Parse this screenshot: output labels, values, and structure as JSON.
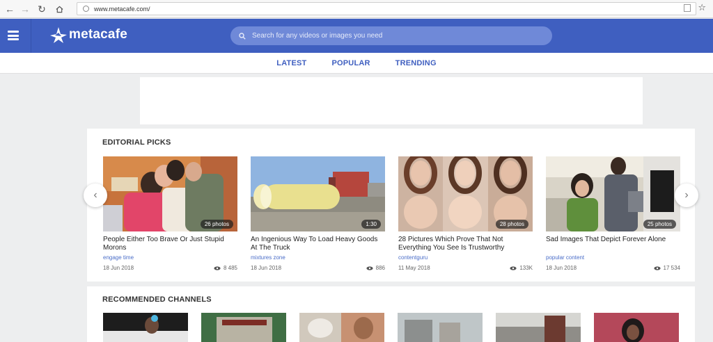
{
  "browser": {
    "url": "www.metacafe.com/",
    "back_icon": "arrow-left",
    "forward_icon": "arrow-right",
    "reload_icon": "reload",
    "home_icon": "home",
    "bookmark_icon": "star"
  },
  "header": {
    "logo_text": "metacafe",
    "search_placeholder": "Search for any videos or images you need",
    "brand_color": "#3f5fc0"
  },
  "subnav": {
    "items": [
      "LATEST",
      "POPULAR",
      "TRENDING"
    ]
  },
  "editorial": {
    "title": "EDITORIAL PICKS",
    "items": [
      {
        "title": "People Either Too Brave Or Just Stupid Morons",
        "source": "engage time",
        "date": "18 Jun 2018",
        "views": "8 485",
        "badge": "26 photos"
      },
      {
        "title": "An Ingenious Way To Load Heavy Goods At The Truck",
        "source": "mixtures zone",
        "date": "18 Jun 2018",
        "views": "886",
        "badge": "1:30"
      },
      {
        "title": "28 Pictures Which Prove That Not Everything You See Is Trustworthy",
        "source": "contentguru",
        "date": "11 May 2018",
        "views": "133K",
        "badge": "28 photos"
      },
      {
        "title": "Sad Images That Depict Forever Alone",
        "source": "popular content",
        "date": "18 Jun 2018",
        "views": "17 534",
        "badge": "25 photos"
      }
    ],
    "prev_icon": "chevron-left",
    "next_icon": "chevron-right"
  },
  "channels": {
    "title": "RECOMMENDED CHANNELS"
  }
}
